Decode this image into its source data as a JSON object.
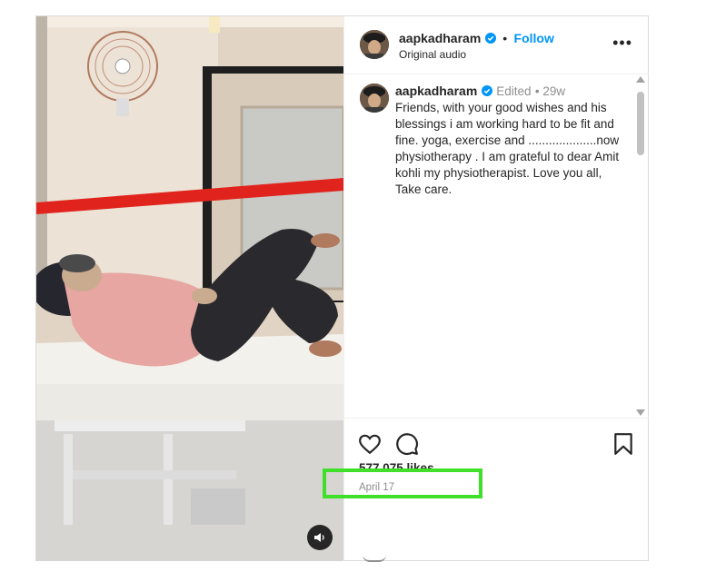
{
  "post": {
    "author": {
      "username": "aapkadharam",
      "verified": true,
      "follow_label": "Follow",
      "subtitle": "Original audio"
    },
    "caption": {
      "username": "aapkadharam",
      "edited_label": "Edited",
      "age": "29w",
      "text": "Friends, with your good wishes and his blessings i am working hard to be fit and fine. yoga, exercise and ....................now physiotherapy . I am grateful to dear Amit kohli my physiotherapist. Love you all, Take care."
    },
    "likes": "577,075 likes",
    "date": "April 17",
    "icons": {
      "more": "more-options-icon",
      "like": "heart-icon",
      "comment": "comment-icon",
      "save": "bookmark-icon",
      "audio": "speaker-icon",
      "verified": "verified-badge-icon"
    },
    "colors": {
      "follow": "#0095f6",
      "verified": "#0095f6",
      "highlight": "#3fe02a",
      "text": "#262626",
      "muted": "#8e8e8e"
    }
  }
}
